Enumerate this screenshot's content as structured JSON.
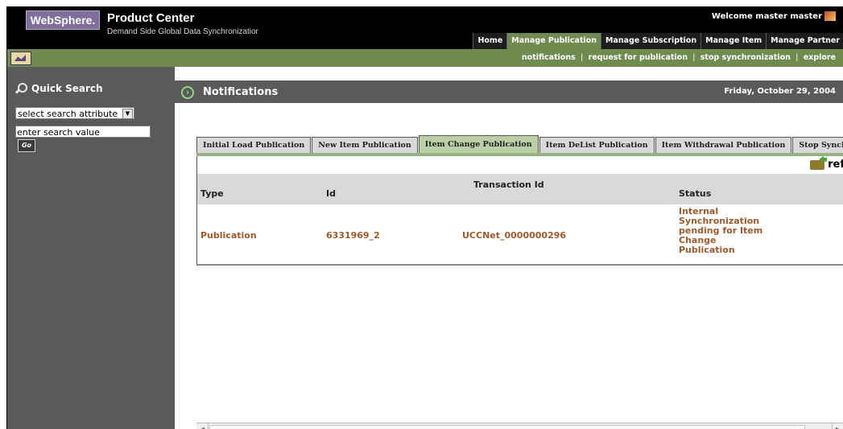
{
  "header": {
    "logo": "WebSphere.",
    "title": "Product Center",
    "subtitle": "Demand Side Global Data Synchronizatior",
    "welcome": "Welcome master master"
  },
  "main_nav": [
    "Home",
    "Manage Publication",
    "Manage Subscription",
    "Manage Item",
    "Manage Partner"
  ],
  "sub_nav": {
    "items": [
      "notifications",
      "request for publication",
      "stop synchronization",
      "explore"
    ],
    "separator": "|"
  },
  "quick_search": {
    "title": "Quick Search",
    "select_value": "select search attribute",
    "input_value": "enter search value",
    "go_label": "Go"
  },
  "page": {
    "title": "Notifications",
    "date": "Friday, October 29, 2004"
  },
  "tabs": [
    "Initial Load Publication",
    "New Item Publication",
    "Item Change Publication",
    "Item DeList Publication",
    "Item Withdrawal Publication",
    "Stop Synchroniza"
  ],
  "active_tab": "Item Change Publication",
  "refresh_label": "ref",
  "table": {
    "columns": [
      "Type",
      "Id",
      "Transaction Id",
      "Status"
    ],
    "rows": [
      {
        "type": "Publication",
        "id": "6331969_2",
        "transaction_id": "UCCNet_0000000296",
        "status": "Internal Synchronization pending for Item Change Publication"
      }
    ]
  },
  "colors": {
    "header_bg": "#000000",
    "nav_active": "#6f8b50",
    "panel_gray": "#5a5a5a",
    "tab_active": "#bbcfa6",
    "row_text": "#9d5b2c"
  }
}
